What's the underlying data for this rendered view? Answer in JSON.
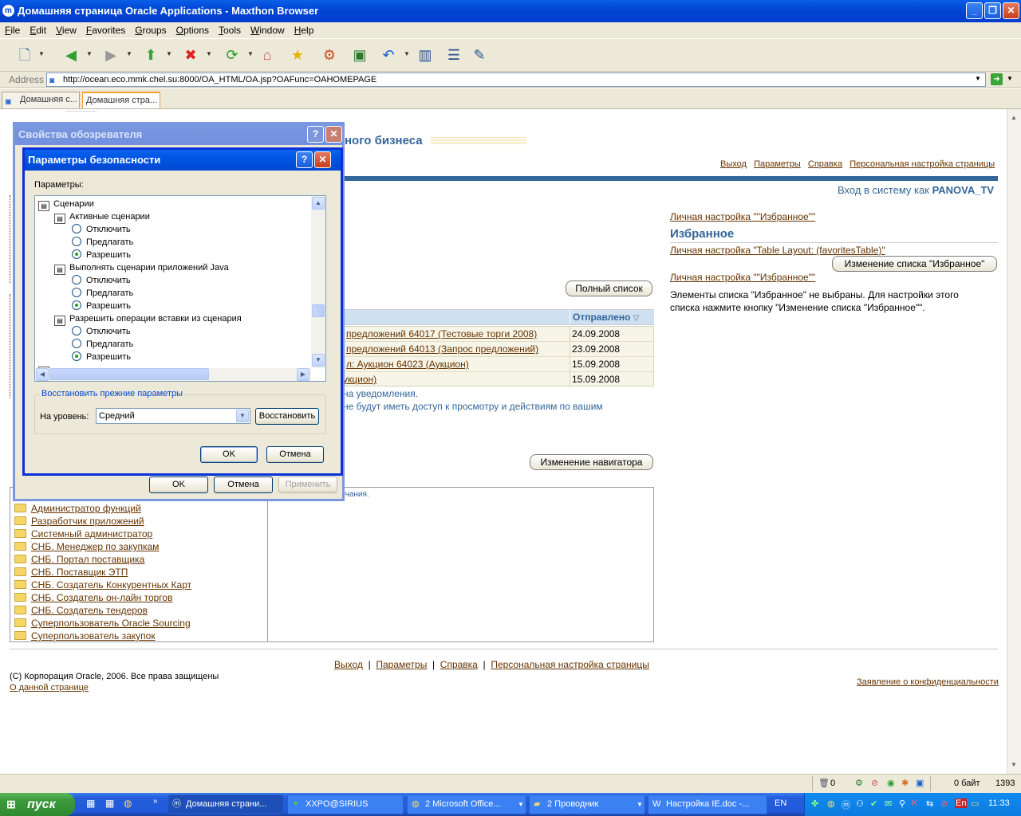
{
  "window": {
    "title": "Домашняя страница Oracle Applications - Maxthon Browser"
  },
  "menu": [
    "File",
    "Edit",
    "View",
    "Favorites",
    "Groups",
    "Options",
    "Tools",
    "Window",
    "Help"
  ],
  "address": {
    "label": "Address",
    "url": "http://ocean.eco.mmk.chel.su:8000/OA_HTML/OA.jsp?OAFunc=OAHOMEPAGE"
  },
  "tabs": [
    {
      "label": "Домашняя с..."
    },
    {
      "label": "Домашняя стра..."
    }
  ],
  "page": {
    "header_fragment": "ного бизнеса",
    "global_links": [
      "Выход",
      "Параметры",
      "Справка",
      "Персональная настройка страницы"
    ],
    "login_prefix": "Вход в систему как",
    "login_user": "PANOVA_TV",
    "full_list_button": "Полный список",
    "notifications": {
      "col_sent": "Отправлено",
      "rows": [
        {
          "subject": "предложений 64017 (Тестовые торги 2008)",
          "date": "24.09.2008"
        },
        {
          "subject": "предложений 64013 (Запрос предложений)",
          "date": "23.09.2008"
        },
        {
          "subject": "л: Аукцион 64023 (Аукцион)",
          "date": "15.09.2008"
        },
        {
          "subject": "укцион)",
          "date": "15.09.2008"
        }
      ],
      "line1": "на уведомления.",
      "line2": "не будут иметь доступ к просмотру и действиям по вашим"
    },
    "change_navigator_button": "Изменение навигатора",
    "default_note": "лчания.",
    "responsibilities": [
      "Администратор функций",
      "Разработчик приложений",
      "Системный администратор",
      "СНБ. Менеджер по закупкам",
      "СНБ. Портал поставщика",
      "СНБ. Поставщик ЭТП",
      "СНБ. Создатель Конкурентных Карт",
      "СНБ. Создатель он-лайн торгов",
      "СНБ. Создатель тендеров",
      "Суперпользователь Oracle Sourcing",
      "Суперпользователь закупок"
    ],
    "favorites": {
      "personalize1": "Личная настройка \"\"Избранное\"\"",
      "heading": "Избранное",
      "personalize_table": "Личная настройка \"Table Layout: (favoritesTable)\"",
      "edit_button": "Изменение списка \"Избранное\"",
      "personalize2": "Личная настройка \"\"Избранное\"\"",
      "empty_text": "Элементы списка \"Избранное\" не выбраны. Для настройки этого списка нажмите кнопку \"Изменение списка \"Избранное\"\"."
    },
    "footer_links": [
      "Выход",
      "Параметры",
      "Справка",
      "Персональная настройка страницы"
    ],
    "copyright": "(C) Корпорация Oracle, 2006. Все права защищены",
    "about": "О данной странице",
    "privacy": "Заявление о конфиденциальности"
  },
  "internet_options": {
    "title": "Свойства обозревателя",
    "ok": "OK",
    "cancel": "Отмена",
    "apply": "Применить"
  },
  "security": {
    "title": "Параметры безопасности",
    "params_label": "Параметры:",
    "tree": [
      {
        "kind": "group",
        "text": "Сценарии"
      },
      {
        "kind": "item",
        "text": "Активные сценарии"
      },
      {
        "kind": "radio",
        "text": "Отключить",
        "on": false
      },
      {
        "kind": "radio",
        "text": "Предлагать",
        "on": false
      },
      {
        "kind": "radio",
        "text": "Разрешить",
        "on": true
      },
      {
        "kind": "item",
        "text": "Выполнять сценарии приложений Java"
      },
      {
        "kind": "radio",
        "text": "Отключить",
        "on": false
      },
      {
        "kind": "radio",
        "text": "Предлагать",
        "on": false
      },
      {
        "kind": "radio",
        "text": "Разрешить",
        "on": true
      },
      {
        "kind": "item",
        "text": "Разрешить операции вставки из сценария"
      },
      {
        "kind": "radio",
        "text": "Отключить",
        "on": false
      },
      {
        "kind": "radio",
        "text": "Предлагать",
        "on": false
      },
      {
        "kind": "radio",
        "text": "Разрешить",
        "on": true
      }
    ],
    "reset_group": "Восстановить прежние параметры",
    "level_label": "На уровень:",
    "level_value": "Средний",
    "restore_button": "Восстановить",
    "ok": "OK",
    "cancel": "Отмена"
  },
  "statusbar": {
    "trash_count": "0",
    "bytes": "0 байт",
    "extra": "1393"
  },
  "taskbar": {
    "start": "пуск",
    "tasks": [
      "Домашняя страни...",
      "XXPO@SIRIUS",
      "2 Microsoft Office...",
      "2 Проводник",
      "Настройка IE.doc -..."
    ],
    "lang": "EN",
    "time": "11:33"
  }
}
